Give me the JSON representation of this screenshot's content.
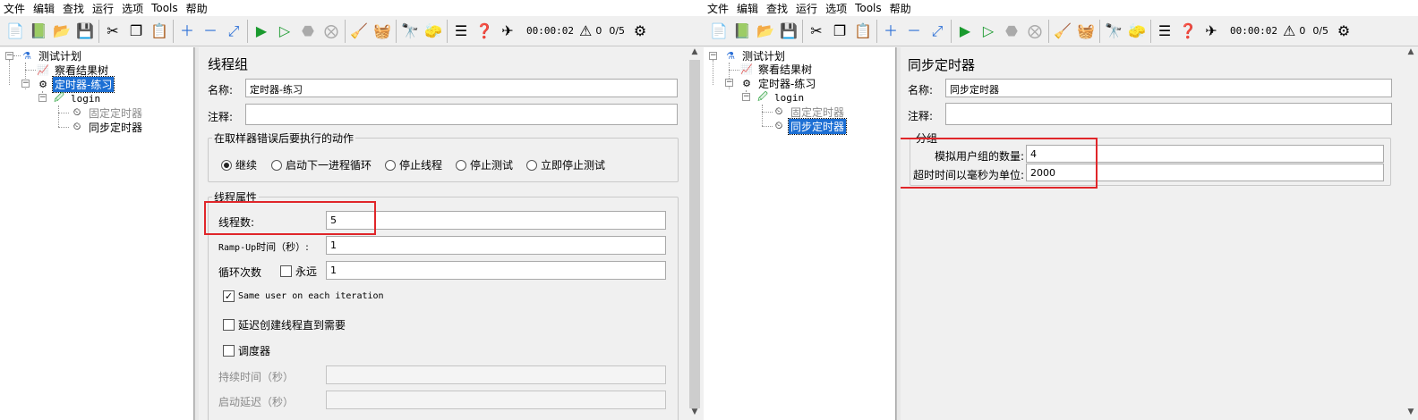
{
  "menu": [
    "文件",
    "编辑",
    "查找",
    "运行",
    "选项",
    "Tools",
    "帮助"
  ],
  "toolbar": {
    "timer": "00:00:02",
    "warn_count": "0",
    "thread_ratio": "0/5"
  },
  "tree": {
    "test_plan": "测试计划",
    "result_tree": "察看结果树",
    "thread_group": "定时器-练习",
    "sampler": "login",
    "const_timer": "固定定时器",
    "sync_timer": "同步定时器"
  },
  "left_panel": {
    "title": "线程组",
    "name_label": "名称:",
    "name_value": "定时器-练习",
    "comment_label": "注释:",
    "comment_value": "",
    "error_group_title": "在取样器错误后要执行的动作",
    "error_actions": [
      {
        "label": "继续",
        "selected": true
      },
      {
        "label": "启动下一进程循环",
        "selected": false
      },
      {
        "label": "停止线程",
        "selected": false
      },
      {
        "label": "停止测试",
        "selected": false
      },
      {
        "label": "立即停止测试",
        "selected": false
      }
    ],
    "props_title": "线程属性",
    "threads_label": "线程数:",
    "threads_value": "5",
    "rampup_label_prefix": "Ramp-Up",
    "rampup_label_suffix": "时间（秒）:",
    "rampup_value": "1",
    "loops_label": "循环次数",
    "forever_label": "永远",
    "loops_value": "1",
    "same_user_label": "Same user on each iteration",
    "delay_label": "延迟创建线程直到需要",
    "scheduler_label": "调度器",
    "duration_label": "持续时间（秒）",
    "duration_value": "",
    "startup_label": "启动延迟（秒）",
    "startup_value": ""
  },
  "right_panel": {
    "title": "同步定时器",
    "name_label": "名称:",
    "name_value": "同步定时器",
    "comment_label": "注释:",
    "comment_value": "",
    "group_title": "分组",
    "users_label": "模拟用户组的数量:",
    "users_value": "4",
    "timeout_label": "超时时间以毫秒为单位:",
    "timeout_value": "2000"
  },
  "colors": {
    "selection": "#1c6fd4",
    "highlight": "#e0262a"
  }
}
